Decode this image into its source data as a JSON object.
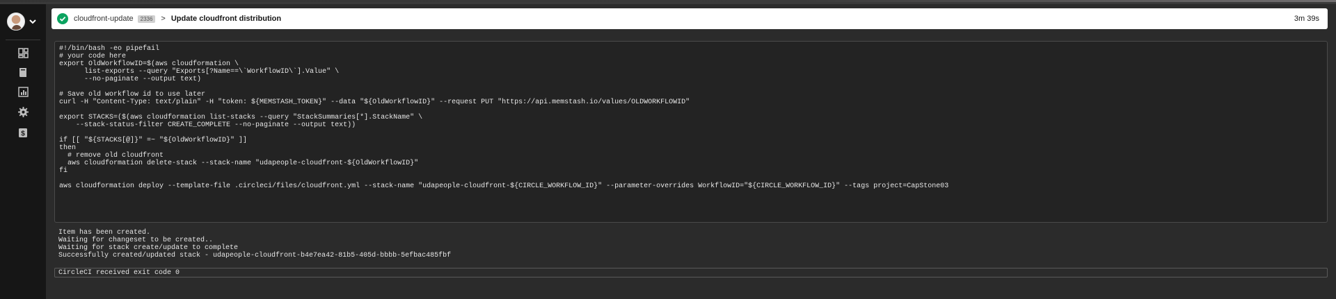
{
  "header": {
    "job_name": "cloudfront-update",
    "job_number": "2336",
    "separator": ">",
    "step_title": "Update cloudfront distribution",
    "duration": "3m 39s",
    "status_color": "#0ba360"
  },
  "sidebar": {
    "items": [
      {
        "icon": "dashboard-icon"
      },
      {
        "icon": "book-icon"
      },
      {
        "icon": "chart-icon"
      },
      {
        "icon": "gear-icon"
      },
      {
        "icon": "dollar-icon"
      }
    ]
  },
  "code": {
    "lines": [
      "#!/bin/bash -eo pipefail",
      "# your code here",
      "export OldWorkflowID=$(aws cloudformation \\",
      "      list-exports --query \"Exports[?Name==\\`WorkflowID\\`].Value\" \\",
      "      --no-paginate --output text)",
      "",
      "# Save old workflow id to use later",
      "curl -H \"Content-Type: text/plain\" -H \"token: ${MEMSTASH_TOKEN}\" --data \"${OldWorkflowID}\" --request PUT \"https://api.memstash.io/values/OLDWORKFLOWID\"",
      "",
      "export STACKS=($(aws cloudformation list-stacks --query \"StackSummaries[*].StackName\" \\",
      "    --stack-status-filter CREATE_COMPLETE --no-paginate --output text))",
      "",
      "if [[ \"${STACKS[@]}\" =~ \"${OldWorkflowID}\" ]]",
      "then",
      "  # remove old cloudfront",
      "  aws cloudformation delete-stack --stack-name \"udapeople-cloudfront-${OldWorkflowID}\"",
      "fi",
      "",
      "aws cloudformation deploy --template-file .circleci/files/cloudfront.yml --stack-name \"udapeople-cloudfront-${CIRCLE_WORKFLOW_ID}\" --parameter-overrides WorkflowID=\"${CIRCLE_WORKFLOW_ID}\" --tags project=CapStone03"
    ]
  },
  "output": {
    "lines": [
      "Item has been created.",
      "Waiting for changeset to be created..",
      "Waiting for stack create/update to complete",
      "Successfully created/updated stack - udapeople-cloudfront-b4e7ea42-81b5-405d-bbbb-5efbac485fbf"
    ],
    "exit_message": "CircleCI received exit code 0"
  }
}
